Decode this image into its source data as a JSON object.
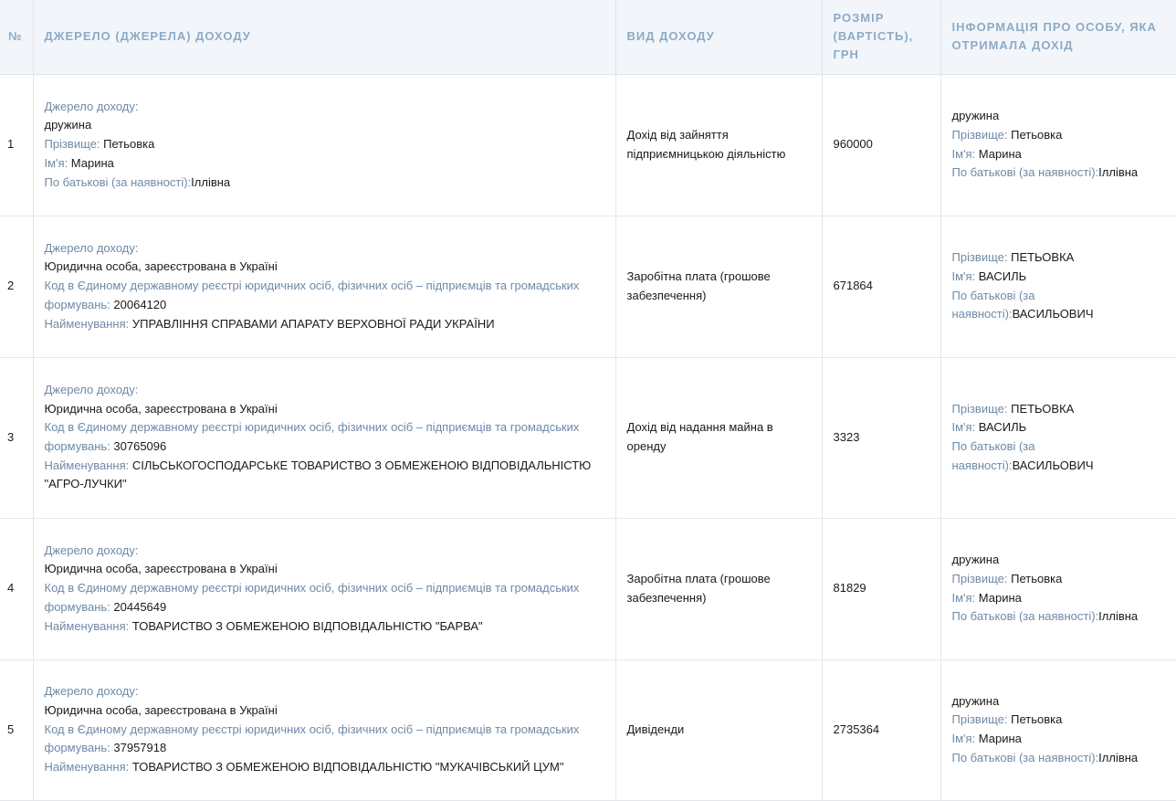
{
  "headers": {
    "num": "№",
    "source": "ДЖЕРЕЛО (ДЖЕРЕЛА) ДОХОДУ",
    "type": "ВИД ДОХОДУ",
    "amount": "РОЗМІР (ВАРТІСТЬ), ГРН",
    "person": "ІНФОРМАЦІЯ ПРО ОСОБУ, ЯКА ОТРИМАЛА ДОХІД"
  },
  "labels": {
    "source": "Джерело доходу:",
    "surname": "Прізвище: ",
    "name": "Ім'я: ",
    "patronymic": "По батькові (за наявності):",
    "code": "Код в Єдиному державному реєстрі юридичних осіб, фізичних осіб – підприємців та громадських формувань: ",
    "title": "Найменування: "
  },
  "rows": [
    {
      "num": "1",
      "source": {
        "kind": "дружина",
        "surname": "Петьовка",
        "name": "Марина",
        "patronymic": "Іллівна"
      },
      "type": "Дохід від зайняття підприємницькою діяльністю",
      "amount": "960000",
      "person": {
        "relation": "дружина",
        "surname": "Петьовка",
        "name": "Марина",
        "patronymic": "Іллівна"
      }
    },
    {
      "num": "2",
      "source": {
        "kind": "Юридична особа, зареєстрована в Україні",
        "code": "20064120",
        "title": "УПРАВЛІННЯ СПРАВАМИ АПАРАТУ ВЕРХОВНОЇ РАДИ УКРАЇНИ"
      },
      "type": "Заробітна плата (грошове забезпечення)",
      "amount": "671864",
      "person": {
        "surname": "ПЕТЬОВКА",
        "name": "ВАСИЛЬ",
        "patronymic": "ВАСИЛЬОВИЧ"
      }
    },
    {
      "num": "3",
      "source": {
        "kind": "Юридична особа, зареєстрована в Україні",
        "code": "30765096",
        "title": "СІЛЬСЬКОГОСПОДАРСЬКЕ ТОВАРИСТВО З ОБМЕЖЕНОЮ ВІДПОВІДАЛЬНІСТЮ \"АГРО-ЛУЧКИ\""
      },
      "type": "Дохід від надання майна в оренду",
      "amount": "3323",
      "person": {
        "surname": "ПЕТЬОВКА",
        "name": "ВАСИЛЬ",
        "patronymic": "ВАСИЛЬОВИЧ"
      }
    },
    {
      "num": "4",
      "source": {
        "kind": "Юридична особа, зареєстрована в Україні",
        "code": "20445649",
        "title": "ТОВАРИСТВО З ОБМЕЖЕНОЮ ВІДПОВІДАЛЬНІСТЮ \"БАРВА\""
      },
      "type": "Заробітна плата (грошове забезпечення)",
      "amount": "81829",
      "person": {
        "relation": "дружина",
        "surname": "Петьовка",
        "name": "Марина",
        "patronymic": "Іллівна"
      }
    },
    {
      "num": "5",
      "source": {
        "kind": "Юридична особа, зареєстрована в Україні",
        "code": "37957918",
        "title": "ТОВАРИСТВО З ОБМЕЖЕНОЮ ВІДПОВІДАЛЬНІСТЮ \"МУКАЧІВСЬКИЙ ЦУМ\""
      },
      "type": "Дивіденди",
      "amount": "2735364",
      "person": {
        "relation": "дружина",
        "surname": "Петьовка",
        "name": "Марина",
        "patronymic": "Іллівна"
      }
    }
  ]
}
